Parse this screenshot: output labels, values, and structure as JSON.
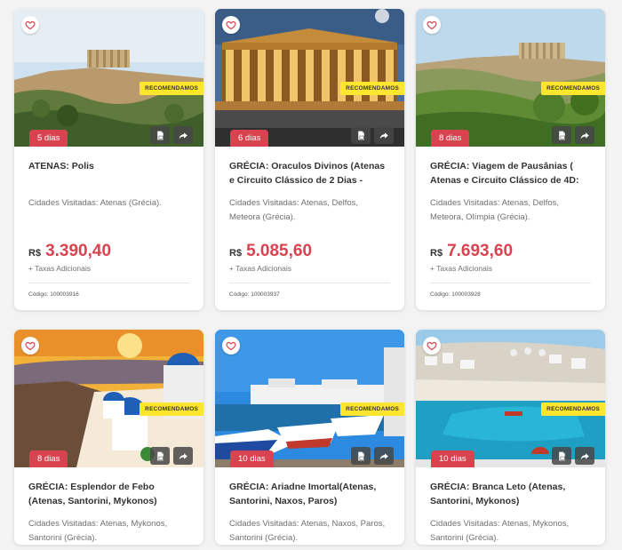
{
  "icons": {
    "favorite": "heart-icon",
    "pdf": "pdf-document-icon",
    "share": "share-arrow-icon"
  },
  "colors": {
    "accent": "#d94350",
    "badge": "#ffe62e",
    "text": "#333333",
    "muted": "#707070"
  },
  "cards": [
    {
      "days": "5 dias",
      "badge": "RECOMENDAMOS",
      "title": "ATENAS: Polis",
      "cities": "Cidades Visitadas: Atenas (Grécia).",
      "currency": "R$",
      "price": "3.390,40",
      "tax": "+ Taxas Adicionais",
      "code": "Código: 100003916"
    },
    {
      "days": "6 dias",
      "badge": "RECOMENDAMOS",
      "title": "GRÉCIA: Oraculos Divinos (Atenas e Circuito Clássico de 2 Dias -",
      "cities": "Cidades Visitadas: Atenas, Delfos, Meteora (Grécia).",
      "currency": "R$",
      "price": "5.085,60",
      "tax": "+ Taxas Adicionais",
      "code": "Código: 100003937"
    },
    {
      "days": "8 dias",
      "badge": "RECOMENDAMOS",
      "title": "GRÉCIA: Viagem de Pausânias ( Atenas e Circuito Clássico de 4D:",
      "cities": "Cidades Visitadas: Atenas, Delfos, Meteora, Olímpia (Grécia).",
      "currency": "R$",
      "price": "7.693,60",
      "tax": "+ Taxas Adicionais",
      "code": "Código: 100003928"
    },
    {
      "days": "8 dias",
      "badge": "RECOMENDAMOS",
      "title": "GRÉCIA: Esplendor de Febo (Atenas, Santorini, Mykonos)",
      "cities": "Cidades Visitadas: Atenas, Mykonos, Santorini (Grécia)."
    },
    {
      "days": "10 dias",
      "badge": "RECOMENDAMOS",
      "title": "GRÉCIA: Ariadne Imortal(Atenas, Santorini, Naxos, Paros)",
      "cities": "Cidades Visitadas: Atenas, Naxos, Paros, Santorini (Grécia)."
    },
    {
      "days": "10 dias",
      "badge": "RECOMENDAMOS",
      "title": "GRÉCIA: Branca Leto (Atenas, Santorini, Mykonos)",
      "cities": "Cidades Visitadas: Atenas, Mykonos, Santorini (Grécia)."
    }
  ]
}
